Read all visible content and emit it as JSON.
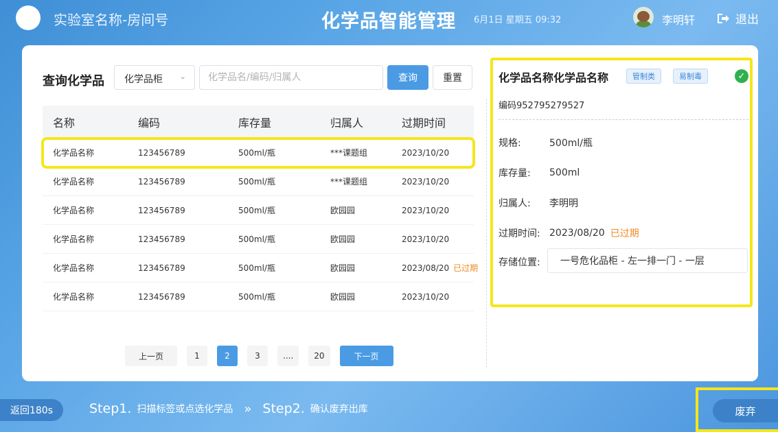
{
  "header": {
    "lab_name": "实验室名称-房间号",
    "app_title": "化学品智能管理",
    "datetime": "6月1日 星期五 09:32",
    "username": "李明轩",
    "logout_label": "退出"
  },
  "search": {
    "label": "查询化学品",
    "select_value": "化学品柜",
    "placeholder": "化学品名/编码/归属人",
    "query_button": "查询",
    "reset_button": "重置"
  },
  "table": {
    "columns": [
      "名称",
      "编码",
      "库存量",
      "归属人",
      "过期时间"
    ],
    "rows": [
      {
        "name": "化学品名称",
        "code": "123456789",
        "stock": "500ml/瓶",
        "owner": "***课题组",
        "expire": "2023/10/20",
        "tag": ""
      },
      {
        "name": "化学品名称",
        "code": "123456789",
        "stock": "500ml/瓶",
        "owner": "***课题组",
        "expire": "2023/10/20",
        "tag": ""
      },
      {
        "name": "化学品名称",
        "code": "123456789",
        "stock": "500ml/瓶",
        "owner": "欧园园",
        "expire": "2023/10/20",
        "tag": ""
      },
      {
        "name": "化学品名称",
        "code": "123456789",
        "stock": "500ml/瓶",
        "owner": "欧园园",
        "expire": "2023/10/20",
        "tag": ""
      },
      {
        "name": "化学品名称",
        "code": "123456789",
        "stock": "500ml/瓶",
        "owner": "欧园园",
        "expire": "2023/08/20",
        "tag": "已过期"
      },
      {
        "name": "化学品名称",
        "code": "123456789",
        "stock": "500ml/瓶",
        "owner": "欧园园",
        "expire": "2023/10/20",
        "tag": ""
      }
    ]
  },
  "pagination": {
    "prev": "上一页",
    "pages": [
      "1",
      "2",
      "3",
      "....",
      "20"
    ],
    "current": "2",
    "next": "下一页"
  },
  "detail": {
    "title": "化学品名称化学品名称",
    "badges": [
      "管制类",
      "易制毒"
    ],
    "code": "编码952795279527",
    "spec_label": "规格:",
    "spec_value": "500ml/瓶",
    "stock_label": "库存量:",
    "stock_value": "500ml",
    "owner_label": "归属人:",
    "owner_value": "李明明",
    "expire_label": "过期时间:",
    "expire_value": "2023/08/20",
    "expire_tag": "已过期",
    "location_label": "存储位置:",
    "location_value": "一号危化品柜 - 左一排一门 - 一层"
  },
  "footer": {
    "back": "返回180s",
    "step1_title": "Step1.",
    "step1_text": "扫描标签或点选化学品",
    "separator": "»",
    "step2_title": "Step2.",
    "step2_text": "确认废弃出库",
    "discard": "废弃"
  },
  "colors": {
    "accent": "#4a9be4",
    "highlight": "#f5e61a",
    "expired": "#f08a24",
    "success": "#31b04e"
  }
}
